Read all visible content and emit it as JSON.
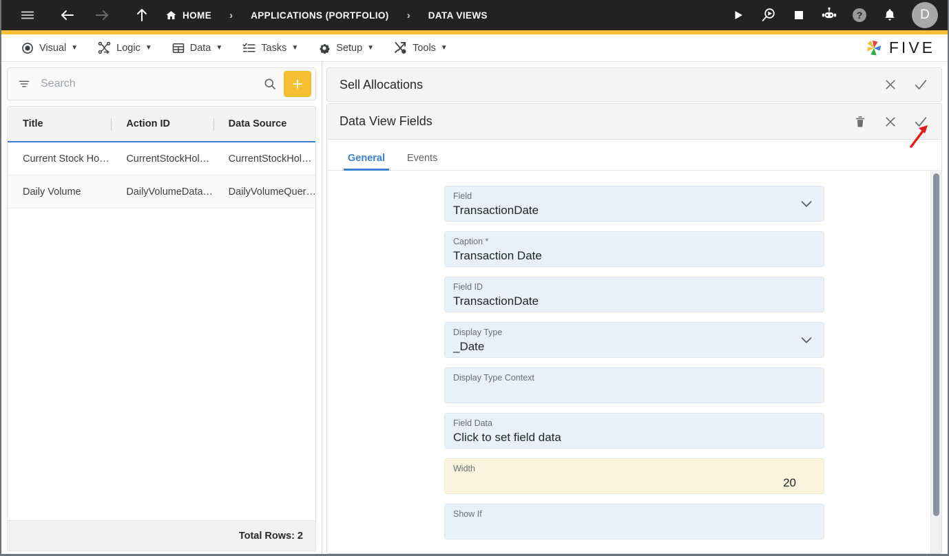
{
  "topbar": {
    "menu_icon": "hamburger-menu-icon",
    "back_icon": "arrow-left-icon",
    "forward_icon": "arrow-right-icon",
    "up_icon": "arrow-up-icon",
    "breadcrumbs": [
      {
        "label": "HOME",
        "icon": "home-icon"
      },
      {
        "label": "APPLICATIONS (PORTFOLIO)",
        "icon": ""
      },
      {
        "label": "DATA VIEWS",
        "icon": ""
      }
    ],
    "separator": "›",
    "actions": [
      {
        "name": "run-button",
        "icon": "play-icon"
      },
      {
        "name": "debug-button",
        "icon": "search-play-icon"
      },
      {
        "name": "stop-button",
        "icon": "stop-square-icon"
      },
      {
        "name": "assistant-button",
        "icon": "robot-icon"
      },
      {
        "name": "help-button",
        "icon": "help-circle-icon"
      },
      {
        "name": "notifications-button",
        "icon": "bell-icon"
      }
    ],
    "avatar_initial": "D",
    "accent_color": "#f5bf32",
    "background": "#222222"
  },
  "menubar": {
    "items": [
      {
        "label": "Visual",
        "icon": "eye-icon",
        "caret": "▼"
      },
      {
        "label": "Logic",
        "icon": "logic-nodes-icon",
        "caret": "▼"
      },
      {
        "label": "Data",
        "icon": "table-grid-icon",
        "caret": "▼"
      },
      {
        "label": "Tasks",
        "icon": "checklist-icon",
        "caret": "▼"
      },
      {
        "label": "Setup",
        "icon": "gear-icon",
        "caret": "▼"
      },
      {
        "label": "Tools",
        "icon": "tools-cross-icon",
        "caret": "▼"
      }
    ],
    "brand": {
      "text": "FIVE",
      "icon": "five-pinwheel-logo"
    }
  },
  "left_panel": {
    "search": {
      "placeholder": "Search",
      "value": "",
      "filter_icon": "filter-icon",
      "search_icon": "search-icon"
    },
    "add_button": {
      "label": "+",
      "color": "#f5bf32"
    },
    "grid": {
      "columns": [
        "Title",
        "Action ID",
        "Data Source"
      ],
      "rows": [
        {
          "title": "Current Stock Ho…",
          "action_id": "CurrentStockHol…",
          "data_source": "CurrentStockHol…"
        },
        {
          "title": "Daily Volume",
          "action_id": "DailyVolumeData…",
          "data_source": "DailyVolumeQuer…"
        }
      ],
      "footer": "Total Rows: 2"
    }
  },
  "right_panel": {
    "record_title": "Sell Allocations",
    "record_actions": [
      {
        "name": "close-record-button",
        "icon": "close-icon"
      },
      {
        "name": "save-record-button",
        "icon": "check-icon"
      }
    ],
    "section_title": "Data View Fields",
    "section_actions": [
      {
        "name": "delete-button",
        "icon": "trash-icon"
      },
      {
        "name": "cancel-button",
        "icon": "close-icon"
      },
      {
        "name": "confirm-button",
        "icon": "check-icon"
      }
    ],
    "tabs": [
      {
        "label": "General",
        "active": true
      },
      {
        "label": "Events",
        "active": false
      }
    ],
    "fields": [
      {
        "label": "Field",
        "value": "TransactionDate",
        "type": "select",
        "state": "normal"
      },
      {
        "label": "Caption *",
        "value": "Transaction Date",
        "type": "text",
        "state": "normal"
      },
      {
        "label": "Field ID",
        "value": "TransactionDate",
        "type": "text",
        "state": "normal"
      },
      {
        "label": "Display Type",
        "value": "_Date",
        "type": "select",
        "state": "normal"
      },
      {
        "label": "Display Type Context",
        "value": "",
        "type": "text",
        "state": "normal"
      },
      {
        "label": "Field Data",
        "value": "Click to set field data",
        "type": "text",
        "state": "normal"
      },
      {
        "label": "Width",
        "value": "20",
        "type": "number",
        "state": "modified"
      },
      {
        "label": "Show If",
        "value": "",
        "type": "text",
        "state": "normal"
      }
    ]
  },
  "annotation": {
    "arrow_color": "#e01b1b",
    "points_to": "confirm-button"
  }
}
